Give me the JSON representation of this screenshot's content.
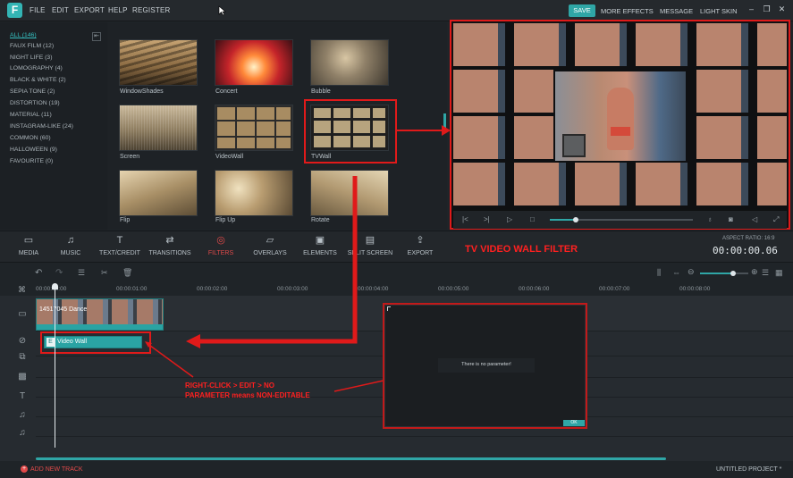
{
  "menu": {
    "logo": "F",
    "items": [
      "FILE",
      "EDIT",
      "EXPORT",
      "HELP",
      "REGISTER"
    ]
  },
  "top_right": {
    "save": "SAVE",
    "more_effects": "MORE EFFECTS",
    "message": "MESSAGE",
    "light_skin": "LIGHT SKIN"
  },
  "categories": [
    {
      "label": "ALL (146)"
    },
    {
      "label": "FAUX FILM (12)"
    },
    {
      "label": "NIGHT LIFE (3)"
    },
    {
      "label": "LOMOGRAPHY (4)"
    },
    {
      "label": "BLACK & WHITE (2)"
    },
    {
      "label": "SEPIA TONE (2)"
    },
    {
      "label": "DISTORTION (19)"
    },
    {
      "label": "MATERIAL (11)"
    },
    {
      "label": "INSTAGRAM-LIKE (24)"
    },
    {
      "label": "COMMON (60)"
    },
    {
      "label": "HALLOWEEN (9)"
    },
    {
      "label": "FAVOURITE (0)"
    }
  ],
  "filters": [
    {
      "label": "WindowShades"
    },
    {
      "label": "Concert"
    },
    {
      "label": "Bubble"
    },
    {
      "label": "Screen"
    },
    {
      "label": "VideoWall"
    },
    {
      "label": "TVWall"
    },
    {
      "label": "Flip"
    },
    {
      "label": "Flip Up"
    },
    {
      "label": "Rotate"
    }
  ],
  "tabs": [
    {
      "label": "MEDIA",
      "icon": "folder-icon",
      "glyph": "▭"
    },
    {
      "label": "MUSIC",
      "icon": "music-icon",
      "glyph": "♫"
    },
    {
      "label": "TEXT/CREDIT",
      "icon": "text-icon",
      "glyph": "T"
    },
    {
      "label": "TRANSITIONS",
      "icon": "transitions-icon",
      "glyph": "⇄"
    },
    {
      "label": "FILTERS",
      "icon": "filters-icon",
      "glyph": "◎"
    },
    {
      "label": "OVERLAYS",
      "icon": "overlays-icon",
      "glyph": "▱"
    },
    {
      "label": "ELEMENTS",
      "icon": "elements-icon",
      "glyph": "▣"
    },
    {
      "label": "SPLIT SCREEN",
      "icon": "split-screen-icon",
      "glyph": "▤"
    },
    {
      "label": "EXPORT",
      "icon": "export-icon",
      "glyph": "⇪"
    }
  ],
  "aspect_ratio": "ASPECT RATIO: 16:9",
  "timecode": "00:00:00.06",
  "annotation_title": "TV VIDEO WALL FILTER",
  "annotation_note_1": "RIGHT-CLICK > EDIT > NO",
  "annotation_note_2": "PARAMETER means NON-EDITABLE",
  "ruler_ticks": [
    "00:00:00:00",
    "00:00:01:00",
    "00:00:02:00",
    "00:00:03:00",
    "00:00:04:00",
    "00:00:05:00",
    "00:00:06:00",
    "00:00:07:00",
    "00:00:08:00"
  ],
  "clip_label": "14517045 Dance",
  "filter_clip_label": "Video Wall",
  "dialog": {
    "message": "There is no parameter!",
    "ok": "OK"
  },
  "add_track": "ADD NEW TRACK",
  "project": "UNTITLED PROJECT *"
}
